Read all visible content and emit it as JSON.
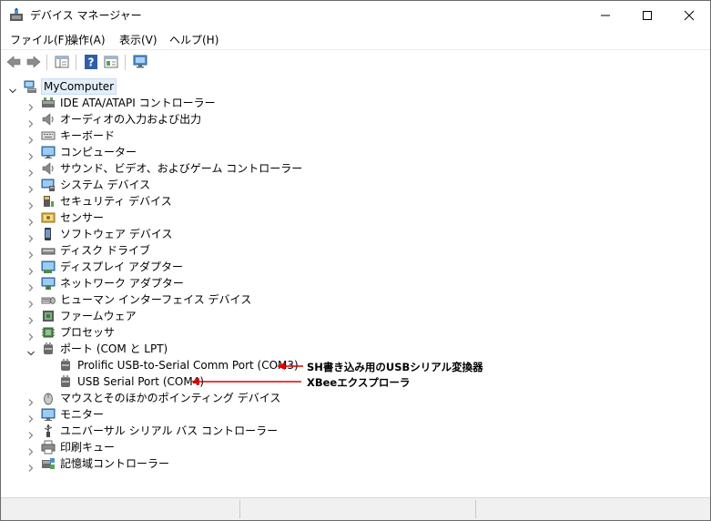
{
  "window": {
    "title": "デバイス マネージャー",
    "app_icon": "device-manager-icon"
  },
  "menu": [
    {
      "label": "ファイル(F)"
    },
    {
      "label": "操作(A)"
    },
    {
      "label": "表示(V)"
    },
    {
      "label": "ヘルプ(H)"
    }
  ],
  "tree": {
    "root": {
      "label": "MyComputer",
      "icon": "computer-icon",
      "expanded": true
    },
    "categories": [
      {
        "label": "IDE ATA/ATAPI コントローラー",
        "icon": "ide-controller-icon",
        "expanded": false
      },
      {
        "label": "オーディオの入力および出力",
        "icon": "speaker-icon",
        "expanded": false
      },
      {
        "label": "キーボード",
        "icon": "keyboard-icon",
        "expanded": false
      },
      {
        "label": "コンピューター",
        "icon": "monitor-icon",
        "expanded": false
      },
      {
        "label": "サウンド、ビデオ、およびゲーム コントローラー",
        "icon": "speaker-icon",
        "expanded": false
      },
      {
        "label": "システム デバイス",
        "icon": "system-device-icon",
        "expanded": false
      },
      {
        "label": "セキュリティ デバイス",
        "icon": "security-device-icon",
        "expanded": false
      },
      {
        "label": "センサー",
        "icon": "sensor-icon",
        "expanded": false
      },
      {
        "label": "ソフトウェア デバイス",
        "icon": "software-device-icon",
        "expanded": false
      },
      {
        "label": "ディスク ドライブ",
        "icon": "disk-drive-icon",
        "expanded": false
      },
      {
        "label": "ディスプレイ アダプター",
        "icon": "display-adapter-icon",
        "expanded": false
      },
      {
        "label": "ネットワーク アダプター",
        "icon": "network-adapter-icon",
        "expanded": false
      },
      {
        "label": "ヒューマン インターフェイス デバイス",
        "icon": "hid-icon",
        "expanded": false
      },
      {
        "label": "ファームウェア",
        "icon": "firmware-icon",
        "expanded": false
      },
      {
        "label": "プロセッサ",
        "icon": "processor-icon",
        "expanded": false
      },
      {
        "label": "ポート (COM と LPT)",
        "icon": "port-icon",
        "expanded": true,
        "children": [
          {
            "label": "Prolific USB-to-Serial Comm Port (COM3)",
            "icon": "port-icon"
          },
          {
            "label": "USB Serial Port (COM4)",
            "icon": "port-icon"
          }
        ]
      },
      {
        "label": "マウスとそのほかのポインティング デバイス",
        "icon": "mouse-icon",
        "expanded": false
      },
      {
        "label": "モニター",
        "icon": "monitor-icon",
        "expanded": false
      },
      {
        "label": "ユニバーサル シリアル バス コントローラー",
        "icon": "usb-icon",
        "expanded": false
      },
      {
        "label": "印刷キュー",
        "icon": "printer-icon",
        "expanded": false
      },
      {
        "label": "記憶域コントローラー",
        "icon": "storage-controller-icon",
        "expanded": false
      }
    ]
  },
  "annotations": [
    {
      "text": "SH書き込み用のUSBシリアル変換器",
      "color": "#e00000"
    },
    {
      "text": "XBeeエクスプローラ",
      "color": "#e00000"
    }
  ],
  "colors": {
    "selection_bg": "#e3eef9",
    "arrow": "#e00000"
  }
}
